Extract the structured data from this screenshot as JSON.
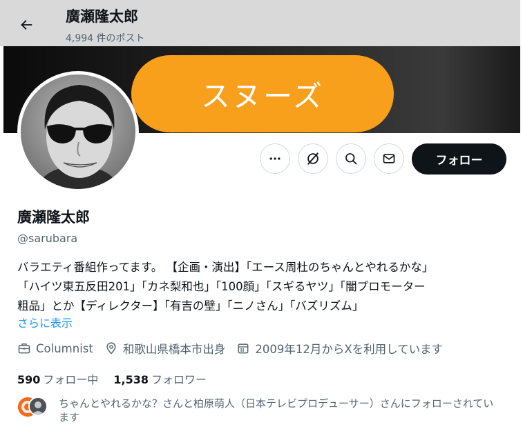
{
  "header": {
    "title": "廣瀬隆太郎",
    "post_count": "4,994 件のポスト",
    "back_icon": "arrow-left-icon"
  },
  "banner": {
    "text": "スヌーズ",
    "pill_color": "#f89f1b"
  },
  "profile": {
    "display_name": "廣瀬隆太郎",
    "handle": "@sarubara",
    "bio_lines": [
      "バラエティ番組作ってます。 【企画・演出】「エース周杜のちゃんとやれるかな」",
      "「ハイツ東五反田201」「カネ梨和也」「100顔」「スギるヤツ」「闇プロモーター",
      "粗品」とか【ディレクター】「有吉の壁」「ニノさん」「バズリズム」"
    ],
    "show_more": "さらに表示",
    "category": "Columnist",
    "location": "和歌山県橋本市出身",
    "joined": "2009年12月からXを利用しています"
  },
  "actions": {
    "more_icon": "more-dots-icon",
    "grok_icon": "grok-icon",
    "search_icon": "search-icon",
    "message_icon": "envelope-icon",
    "follow_label": "フォロー"
  },
  "stats": {
    "following_count": "590",
    "following_label": "フォロー中",
    "followers_count": "1,538",
    "followers_label": "フォロワー"
  },
  "followers_you_know": {
    "text": "ちゃんとやれるかな？さんと柏原萌人（日本テレビプロデューサー）さんにフォローされています"
  },
  "colors": {
    "accent_link": "#1d9bf0",
    "follow_button": "#0f1419",
    "secondary_text": "#536471"
  }
}
